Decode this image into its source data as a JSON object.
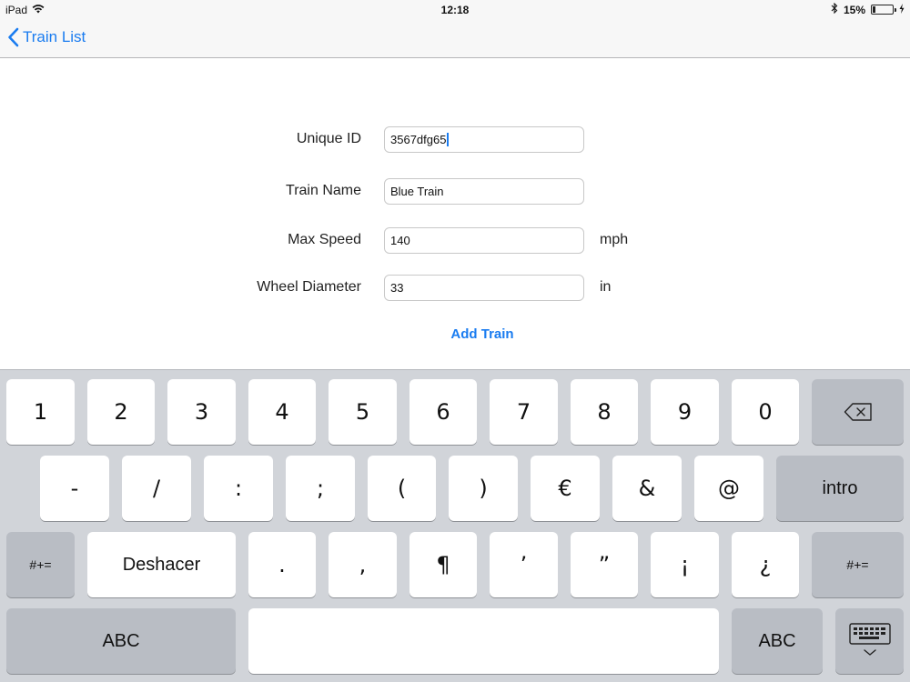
{
  "status_bar": {
    "device": "iPad",
    "time": "12:18",
    "battery": "15%",
    "battery_level": 0.15
  },
  "nav": {
    "back_label": "Train List"
  },
  "form": {
    "unique_id_label": "Unique ID",
    "unique_id_value": "3567dfg65",
    "train_name_label": "Train Name",
    "train_name_value": "Blue Train",
    "max_speed_label": "Max Speed",
    "max_speed_value": "140",
    "max_speed_unit": "mph",
    "wheel_diameter_label": "Wheel Diameter",
    "wheel_diameter_value": "33",
    "wheel_diameter_unit": "in",
    "add_button": "Add Train"
  },
  "keyboard": {
    "row1": [
      "1",
      "2",
      "3",
      "4",
      "5",
      "6",
      "7",
      "8",
      "9",
      "0"
    ],
    "row2": [
      "-",
      "/",
      ":",
      ";",
      "(",
      ")",
      "€",
      "&",
      "@"
    ],
    "return_key": "intro",
    "symbols_key": "#+=",
    "undo_key": "Deshacer",
    "row3": [
      ".",
      ",",
      "¶",
      "’",
      "”",
      "¡",
      "¿"
    ],
    "abc_key": "ABC",
    "icons": {
      "delete": "delete-backspace-icon",
      "dismiss": "keyboard-dismiss-icon"
    }
  }
}
